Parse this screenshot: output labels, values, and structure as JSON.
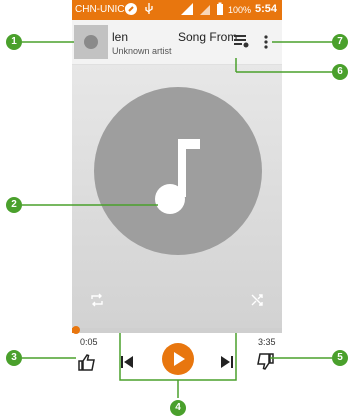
{
  "status_bar": {
    "carrier": "CHN-UNICO",
    "battery_percent": "100%",
    "time": "5:54"
  },
  "now_playing": {
    "title_part1": "len",
    "title_part2": "Song From A",
    "artist": "Unknown artist"
  },
  "playback": {
    "elapsed": "0:05",
    "duration": "3:35",
    "progress_fraction": 0.02
  },
  "callouts": [
    "1",
    "2",
    "3",
    "4",
    "5",
    "6",
    "7"
  ],
  "colors": {
    "accent": "#e8760e",
    "callout": "#4aa02c"
  },
  "icons": {
    "queue": "queue-list-icon",
    "menu": "more-vert-icon",
    "repeat": "repeat-icon",
    "shuffle": "shuffle-icon",
    "thumbs_up": "thumbs-up-icon",
    "thumbs_down": "thumbs-down-icon",
    "previous": "skip-previous-icon",
    "play": "play-icon",
    "next": "skip-next-icon"
  }
}
